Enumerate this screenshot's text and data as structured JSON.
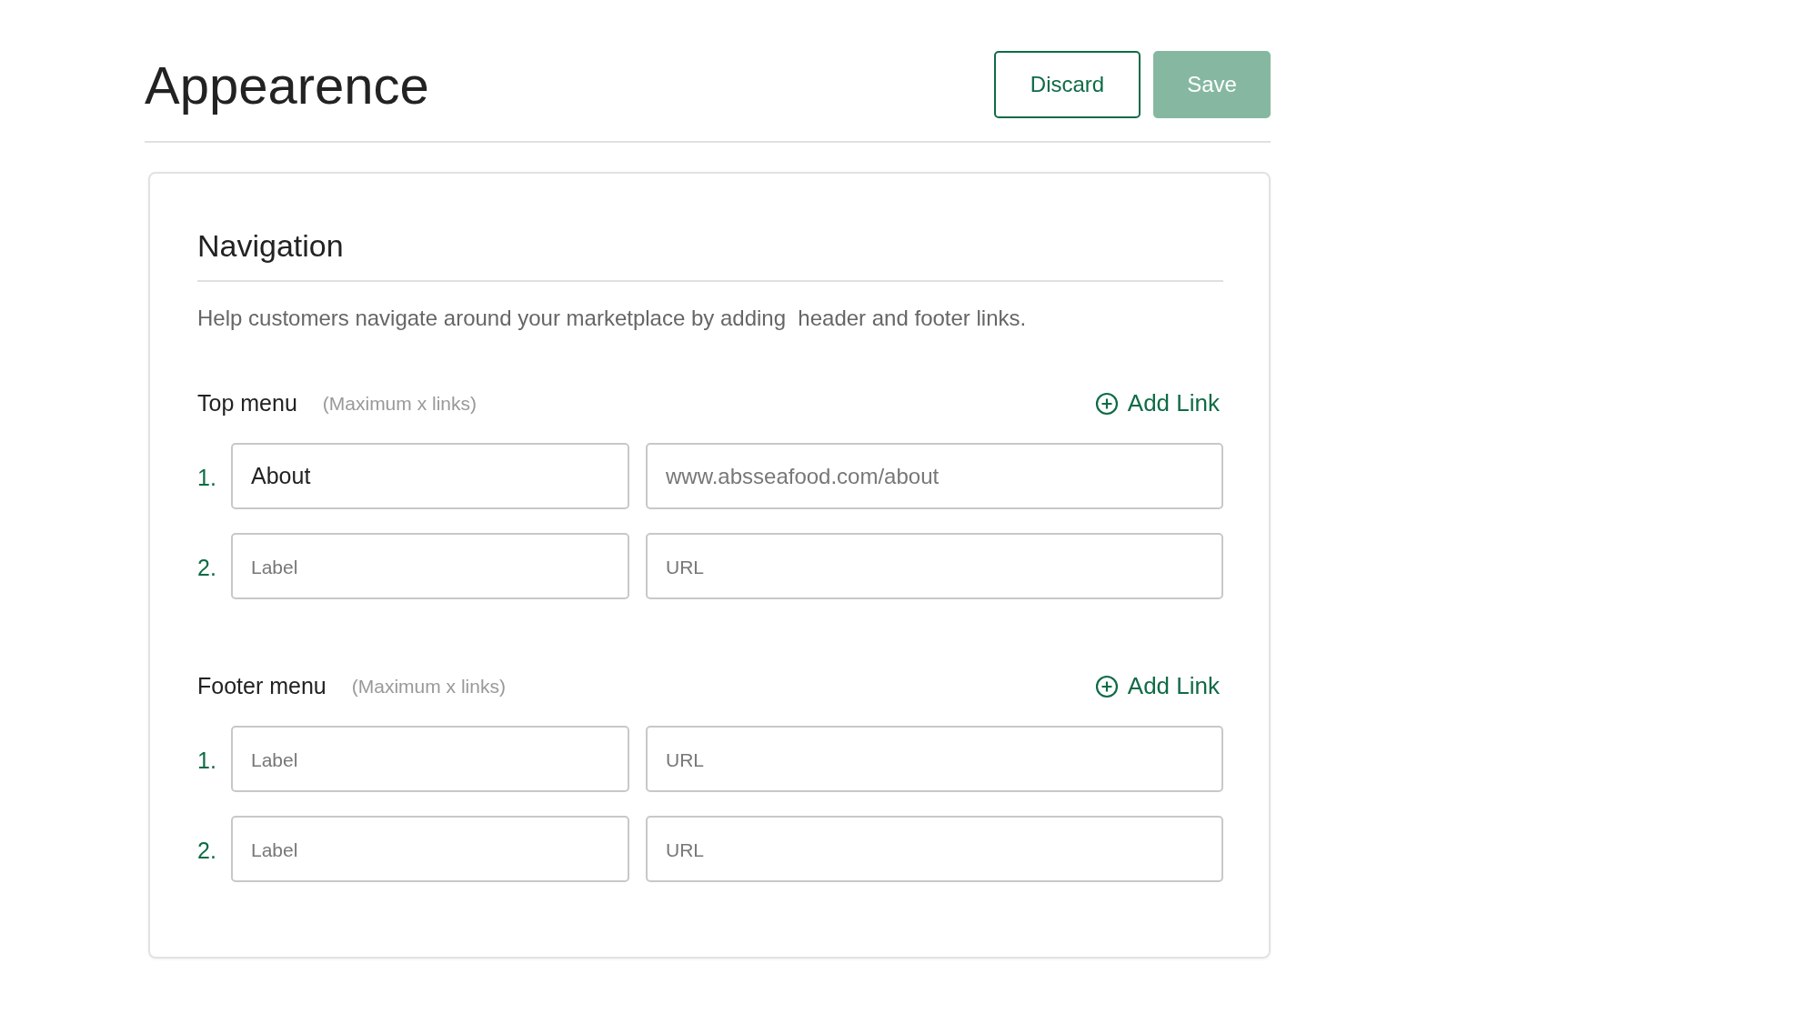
{
  "page": {
    "title": "Appearence"
  },
  "actions": [
    {
      "label": "Discard",
      "kind": "outline",
      "disabled": false
    },
    {
      "label": "Save",
      "kind": "primary",
      "disabled": true
    }
  ],
  "card": {
    "title": "Navigation",
    "description": "Help customers navigate around your marketplace by adding  header and footer links.",
    "menus": [
      {
        "title": "Top menu",
        "hint": "(Maximum x links)",
        "add_label": "Add Link",
        "links": [
          {
            "number": "1.",
            "label": {
              "value": "About"
            },
            "url": {
              "value": "www.absseafood.com/about"
            }
          },
          {
            "number": "2.",
            "label": {
              "placeholder": "Label"
            },
            "url": {
              "placeholder": "URL"
            }
          }
        ]
      },
      {
        "title": "Footer menu",
        "hint": "(Maximum x links)",
        "add_label": "Add Link",
        "links": [
          {
            "number": "1.",
            "label": {
              "placeholder": "Label"
            },
            "url": {
              "placeholder": "URL"
            }
          },
          {
            "number": "2.",
            "label": {
              "placeholder": "Label"
            },
            "url": {
              "placeholder": "URL"
            }
          }
        ]
      }
    ]
  }
}
